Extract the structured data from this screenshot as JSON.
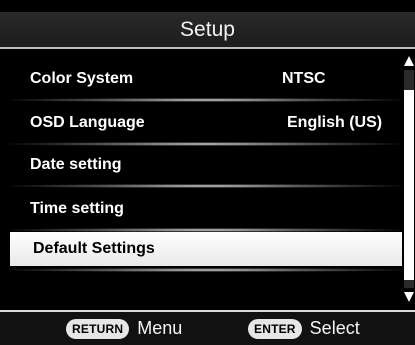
{
  "header": {
    "title": "Setup"
  },
  "menu": {
    "items": [
      {
        "label": "Color System",
        "value": "NTSC"
      },
      {
        "label": "OSD Language",
        "value": "English (US)"
      },
      {
        "label": "Date setting",
        "value": ""
      },
      {
        "label": "Time setting",
        "value": ""
      },
      {
        "label": "Default Settings",
        "value": ""
      }
    ],
    "selected_index": 4
  },
  "footer": {
    "return_key": "RETURN",
    "return_action": "Menu",
    "enter_key": "ENTER",
    "enter_action": "Select"
  },
  "colors": {
    "background": "#000000",
    "text": "#ffffff",
    "highlight": "#f2f2f2"
  }
}
